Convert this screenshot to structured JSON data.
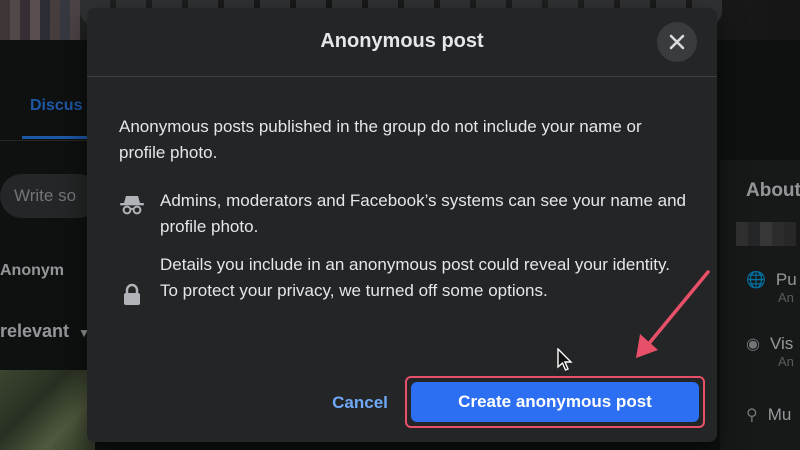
{
  "background": {
    "tab_label": "Discus",
    "write_placeholder": "Write so",
    "anonymous_label": "Anonym",
    "sort_label": "relevant",
    "about_title": "About",
    "right_rows": [
      {
        "icon": "globe-icon",
        "title": "Pu",
        "sub": "An"
      },
      {
        "icon": "eye-icon",
        "title": "Vis",
        "sub": "An"
      },
      {
        "icon": "location-pin-icon",
        "title": "Mu",
        "sub": ""
      }
    ]
  },
  "dialog": {
    "title": "Anonymous post",
    "intro": "Anonymous posts published in the group do not include your name or profile photo.",
    "items": [
      {
        "icon": "incognito-icon",
        "text": "Admins, moderators and Facebook’s systems can see your name and profile photo."
      },
      {
        "icon": "lock-icon",
        "text": "Details you include in an anonymous post could reveal your identity. To protect your privacy, we turned off some options."
      }
    ],
    "cancel_label": "Cancel",
    "create_label": "Create anonymous post"
  },
  "colors": {
    "accent": "#2d6ff2",
    "link": "#6ea8f7",
    "highlight": "#e8506a",
    "dialog_bg": "#242526"
  }
}
